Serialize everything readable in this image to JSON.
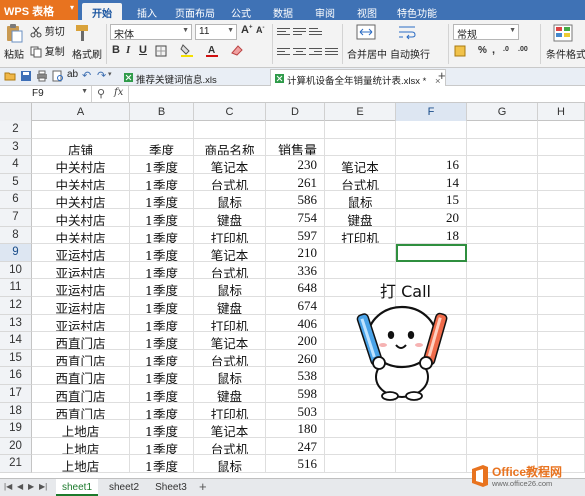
{
  "app": {
    "name": "WPS 表格"
  },
  "ribbon_tabs": [
    "开始",
    "插入",
    "页面布局",
    "公式",
    "数据",
    "审阅",
    "视图",
    "特色功能"
  ],
  "ribbon": {
    "cut": "剪切",
    "paste": "粘贴",
    "copy": "复制",
    "format_painter": "格式刷",
    "font_name": "宋体",
    "font_size": "11",
    "merge_center": "合并居中",
    "wrap_text": "自动换行",
    "number_format": "常规",
    "cond_format": "条件格式"
  },
  "doc_tabs": [
    "推荐关键词信息.xls",
    "计算机设备全年销量统计表.xlsx *"
  ],
  "formula_bar": {
    "cell_ref": "F9",
    "fx": "fx",
    "value": ""
  },
  "columns": [
    "A",
    "B",
    "C",
    "D",
    "E",
    "F",
    "G",
    "H"
  ],
  "rows": [
    {
      "n": "2",
      "a": "",
      "b": "",
      "c": "",
      "d": "",
      "e": "",
      "f": ""
    },
    {
      "n": "3",
      "a": "店铺",
      "b": "季度",
      "c": "商品名称",
      "d": "销售量",
      "e": "",
      "f": ""
    },
    {
      "n": "4",
      "a": "中关村店",
      "b": "1季度",
      "c": "笔记本",
      "d": "230",
      "e": "笔记本",
      "f": "16"
    },
    {
      "n": "5",
      "a": "中关村店",
      "b": "1季度",
      "c": "台式机",
      "d": "261",
      "e": "台式机",
      "f": "14"
    },
    {
      "n": "6",
      "a": "中关村店",
      "b": "1季度",
      "c": "鼠标",
      "d": "586",
      "e": "鼠标",
      "f": "15"
    },
    {
      "n": "7",
      "a": "中关村店",
      "b": "1季度",
      "c": "键盘",
      "d": "754",
      "e": "键盘",
      "f": "20"
    },
    {
      "n": "8",
      "a": "中关村店",
      "b": "1季度",
      "c": "打印机",
      "d": "597",
      "e": "打印机",
      "f": "18"
    },
    {
      "n": "9",
      "a": "亚运村店",
      "b": "1季度",
      "c": "笔记本",
      "d": "210",
      "e": "",
      "f": ""
    },
    {
      "n": "10",
      "a": "亚运村店",
      "b": "1季度",
      "c": "台式机",
      "d": "336",
      "e": "",
      "f": ""
    },
    {
      "n": "11",
      "a": "亚运村店",
      "b": "1季度",
      "c": "鼠标",
      "d": "648",
      "e": "",
      "f": ""
    },
    {
      "n": "12",
      "a": "亚运村店",
      "b": "1季度",
      "c": "键盘",
      "d": "674",
      "e": "",
      "f": ""
    },
    {
      "n": "13",
      "a": "亚运村店",
      "b": "1季度",
      "c": "打印机",
      "d": "406",
      "e": "",
      "f": ""
    },
    {
      "n": "14",
      "a": "西直门店",
      "b": "1季度",
      "c": "笔记本",
      "d": "200",
      "e": "",
      "f": ""
    },
    {
      "n": "15",
      "a": "西直门店",
      "b": "1季度",
      "c": "台式机",
      "d": "260",
      "e": "",
      "f": ""
    },
    {
      "n": "16",
      "a": "西直门店",
      "b": "1季度",
      "c": "鼠标",
      "d": "538",
      "e": "",
      "f": ""
    },
    {
      "n": "17",
      "a": "西直门店",
      "b": "1季度",
      "c": "键盘",
      "d": "598",
      "e": "",
      "f": ""
    },
    {
      "n": "18",
      "a": "西直门店",
      "b": "1季度",
      "c": "打印机",
      "d": "503",
      "e": "",
      "f": ""
    },
    {
      "n": "19",
      "a": "上地店",
      "b": "1季度",
      "c": "笔记本",
      "d": "180",
      "e": "",
      "f": ""
    },
    {
      "n": "20",
      "a": "上地店",
      "b": "1季度",
      "c": "台式机",
      "d": "247",
      "e": "",
      "f": ""
    },
    {
      "n": "21",
      "a": "上地店",
      "b": "1季度",
      "c": "鼠标",
      "d": "516",
      "e": "",
      "f": ""
    }
  ],
  "sheet_tabs": [
    "sheet1",
    "sheet2",
    "Sheet3"
  ],
  "sticker": {
    "text": "打 Call"
  },
  "logo": {
    "name": "Office教程网",
    "url": "www.office26.com"
  },
  "colors": {
    "accent": "#3f72b5",
    "app_button": "#e8731f",
    "selection": "#2f8f3f"
  }
}
